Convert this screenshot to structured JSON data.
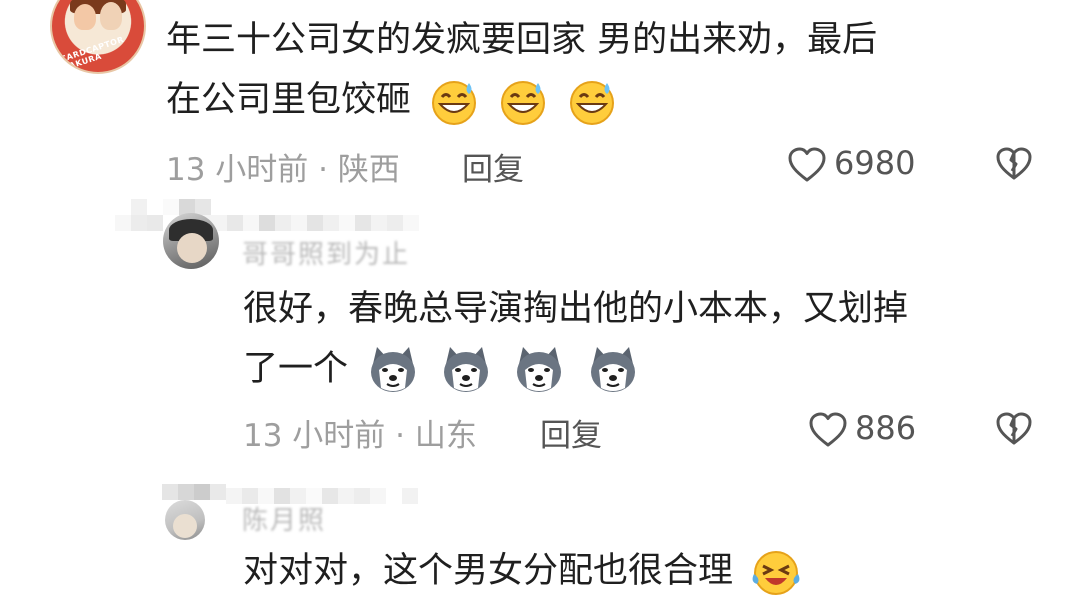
{
  "comments": [
    {
      "line1": "年三十公司女的发疯要回家 男的出来劝，最后",
      "line2": "在公司里包饺砸",
      "emoji": "grinning-sweat-emoji",
      "time": "13 小时前 · 陕西",
      "reply": "回复",
      "likes": "6980"
    },
    {
      "username": "哥哥照到为止",
      "line1": "很好，春晚总导演掏出他的小本本，又划掉",
      "line2": "了一个",
      "emoji": "husky-dog-emoji",
      "time": "13 小时前 · 山东",
      "reply": "回复",
      "likes": "886"
    },
    {
      "username": "陈月照",
      "line1": "对对对，这个男女分配也很合理",
      "emoji": "laughing-tears-emoji"
    }
  ],
  "avatar_text": "CARDCAPTOR SAKURA",
  "colors": {
    "text": "#1f1f1f",
    "meta": "#9e9e9e",
    "icon": "#555555"
  }
}
